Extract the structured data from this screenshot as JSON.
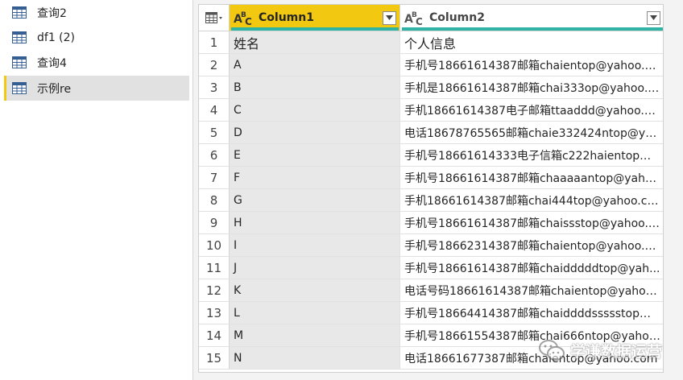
{
  "queries": [
    {
      "label": "查询2",
      "selected": false
    },
    {
      "label": "df1 (2)",
      "selected": false
    },
    {
      "label": "查询4",
      "selected": false
    },
    {
      "label": "示例re",
      "selected": true
    }
  ],
  "grid": {
    "columns": [
      {
        "title": "Column1",
        "type_icon": "abc-type-icon",
        "active": true
      },
      {
        "title": "Column2",
        "type_icon": "abc-type-icon",
        "active": false
      }
    ],
    "rows": [
      {
        "index": "1",
        "col1": "姓名",
        "col2": "个人信息"
      },
      {
        "index": "2",
        "col1": "A",
        "col2": "手机号18661614387邮箱chaientop@yahoo.c..."
      },
      {
        "index": "3",
        "col1": "B",
        "col2": "手机是18661614387邮箱chai333op@yahoo.co..."
      },
      {
        "index": "4",
        "col1": "C",
        "col2": "手机18661614387电子邮箱ttaaddd@yahoo.c..."
      },
      {
        "index": "5",
        "col1": "D",
        "col2": "电话18678765565邮箱chaie332424ntop@yah..."
      },
      {
        "index": "6",
        "col1": "E",
        "col2": "手机号18661614333电子信箱c222haientop@..."
      },
      {
        "index": "7",
        "col1": "F",
        "col2": "手机号18661614387邮箱chaaaaantop@yaho..."
      },
      {
        "index": "8",
        "col1": "G",
        "col2": "手机18661614387邮箱chai444top@yahoo.com"
      },
      {
        "index": "9",
        "col1": "H",
        "col2": "手机号18661614387邮箱chaissstop@yahoo.c..."
      },
      {
        "index": "10",
        "col1": "I",
        "col2": "手机号18662314387邮箱chaientop@yahoo.c..."
      },
      {
        "index": "11",
        "col1": "J",
        "col2": "手机号18661614387邮箱chaidddddtop@yah..."
      },
      {
        "index": "12",
        "col1": "K",
        "col2": "电话号码18661614387邮箱chaientop@yahoo..."
      },
      {
        "index": "13",
        "col1": "L",
        "col2": "手机号18664414387邮箱chaiddddssssstop@y..."
      },
      {
        "index": "14",
        "col1": "M",
        "col2": "手机号18661554387邮箱chai666ntop@yahoo..."
      },
      {
        "index": "15",
        "col1": "N",
        "col2": "电话18661677387邮箱chaientop@yahoo.com"
      }
    ]
  },
  "watermark": {
    "text": "学谦数据运营",
    "icon": "wechat-icon"
  },
  "colors": {
    "accent": "#f2c811",
    "quality_bar": "#2fb3a5",
    "selected_bg": "#e1e1e1",
    "column_highlight": "#e8e8e8"
  }
}
